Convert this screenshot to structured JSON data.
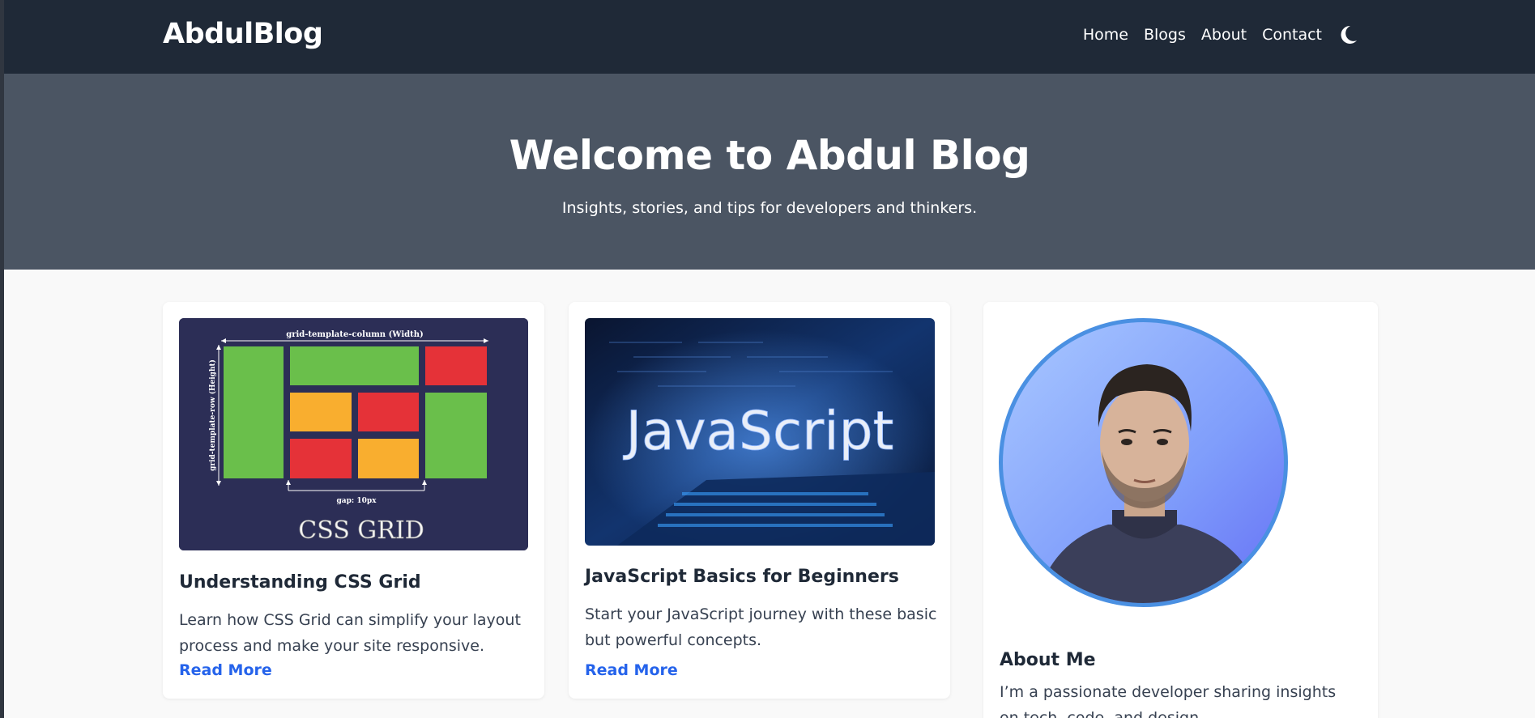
{
  "site": {
    "logo": "AbdulBlog"
  },
  "nav": {
    "links": [
      "Home",
      "Blogs",
      "About",
      "Contact"
    ],
    "theme_toggle_icon": "moon-icon"
  },
  "hero": {
    "title": "Welcome to Abdul Blog",
    "subtitle": "Insights, stories, and tips for developers and thinkers."
  },
  "posts": [
    {
      "title": "Understanding CSS Grid",
      "excerpt": "Learn how CSS Grid can simplify your layout process and make your site responsive.",
      "link_label": "Read More",
      "image": {
        "caption": "CSS GRID",
        "column_label": "grid-template-column (Width)",
        "row_label": "grid-template-row (Height)",
        "gap_label": "gap: 10px"
      }
    },
    {
      "title": "JavaScript Basics for Beginners",
      "excerpt": "Start your JavaScript journey with these basic but powerful concepts.",
      "link_label": "Read More",
      "image": {
        "caption": "JavaScript"
      }
    }
  ],
  "about": {
    "title": "About Me",
    "text": "I’m a passionate developer sharing insights on tech, code, and design."
  },
  "colors": {
    "navbar_bg": "#1f2937",
    "hero_bg": "#4b5563",
    "link_accent": "#2563eb",
    "avatar_ring": "#4a90e2"
  }
}
